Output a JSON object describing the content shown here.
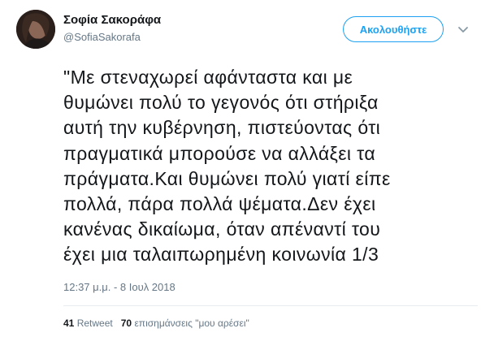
{
  "user": {
    "name": "Σοφία Σακοράφα",
    "handle": "@SofiaSakorafa"
  },
  "follow_button": {
    "label": "Ακολουθήστε",
    "color": "#1da1f2"
  },
  "menu": {
    "icon": "chevron-down-icon"
  },
  "tweet": {
    "lines": [
      "\"Με στεναχωρεί αφάνταστα και με",
      "θυμώνει πολύ το γεγονός ότι στήριξα",
      "αυτή την κυβέρνηση, πιστεύοντας ότι",
      "πραγματικά μπορούσε να αλλάξει τα",
      "πράγματα.Και θυμώνει πολύ γιατί είπε",
      "πολλά, πάρα πολλά ψέματα.Δεν έχει",
      "κανένας δικαίωμα, όταν απέναντί του",
      "έχει μια ταλαιπωρημένη κοινωνία 1/3"
    ],
    "timestamp": "12:37 μ.μ. - 8 Ιουλ 2018"
  },
  "stats": {
    "retweets_count": "41",
    "retweets_label": "Retweet",
    "likes_count": "70",
    "likes_label": "επισημάνσεις \"μου αρέσει\""
  },
  "colors": {
    "text": "#14171a",
    "secondary": "#657786",
    "divider": "#e6ecf0"
  }
}
